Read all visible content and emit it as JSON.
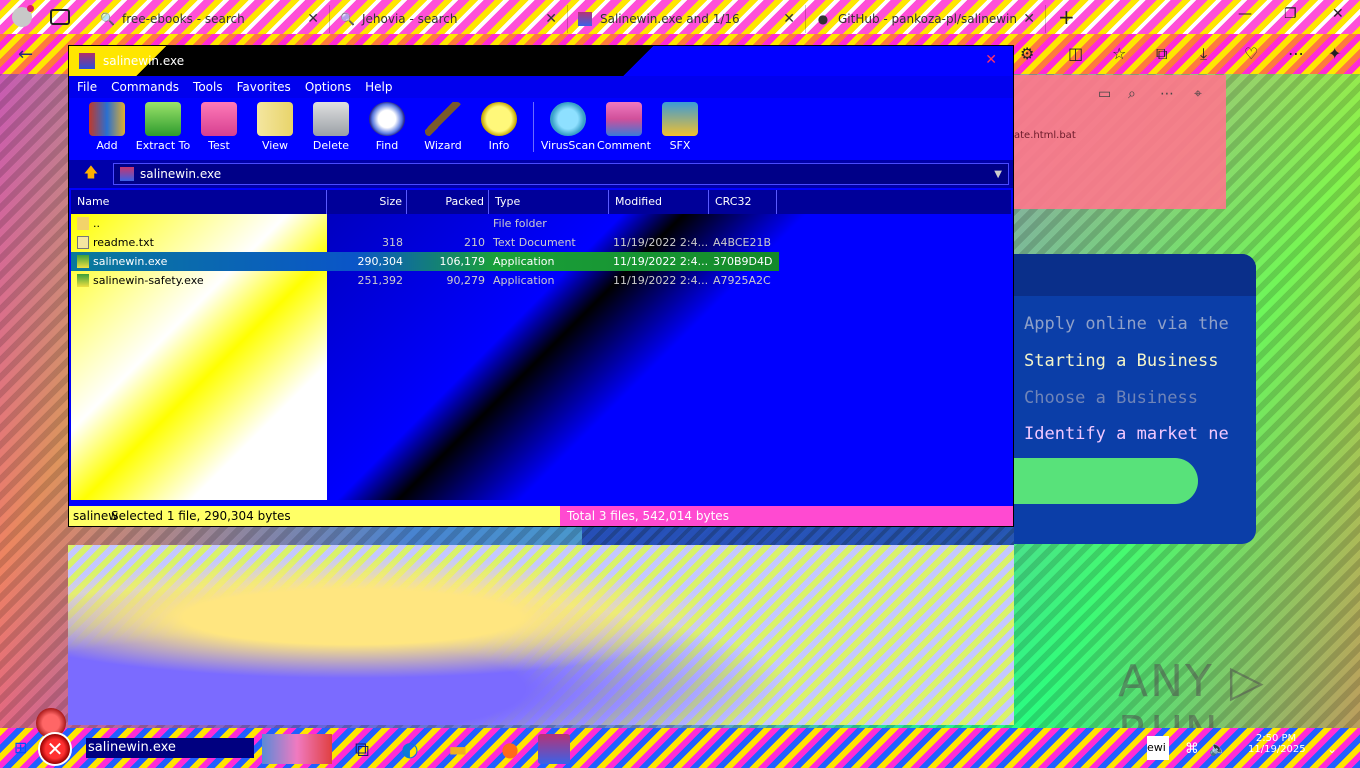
{
  "browser": {
    "tabs": [
      {
        "label": "free-ebooks - search",
        "icon": "search-icon"
      },
      {
        "label": "Jehovia - search",
        "icon": "search-icon"
      },
      {
        "label": "Salinewin.exe and 1/16",
        "icon": "winrar-icon"
      },
      {
        "label": "GitHub - pankoza-pl/salinewin",
        "icon": "github-icon"
      }
    ],
    "new_tab": "+"
  },
  "winrar": {
    "title": "salinewin.exe",
    "menu": [
      "File",
      "Commands",
      "Tools",
      "Favorites",
      "Options",
      "Help"
    ],
    "toolbar": [
      {
        "label": "Add",
        "icon": "add-archive-icon",
        "color": "#c0392b"
      },
      {
        "label": "Extract To",
        "icon": "extract-folder-icon",
        "color": "#2e9b2e"
      },
      {
        "label": "Test",
        "icon": "test-clipboard-icon",
        "color": "#d64090"
      },
      {
        "label": "View",
        "icon": "view-book-icon",
        "color": "#e8d46a"
      },
      {
        "label": "Delete",
        "icon": "delete-bin-icon",
        "color": "#9aa0a6"
      },
      {
        "label": "Find",
        "icon": "find-magnifier-icon",
        "color": "#d8d8ff"
      },
      {
        "label": "Wizard",
        "icon": "wizard-wand-icon",
        "color": "#7a5a2a"
      },
      {
        "label": "Info",
        "icon": "info-icon",
        "color": "#f0e23a"
      },
      {
        "label": "VirusScan",
        "icon": "virusscan-icon",
        "color": "#3aa0c8"
      },
      {
        "label": "Comment",
        "icon": "comment-books-icon",
        "color": "#d0509a"
      },
      {
        "label": "SFX",
        "icon": "sfx-box-icon",
        "color": "#f0c030"
      }
    ],
    "path": "salinewin.exe",
    "columns": [
      "Name",
      "Size",
      "Packed",
      "Type",
      "Modified",
      "CRC32"
    ],
    "files": [
      {
        "name": "..",
        "size": "",
        "packed": "",
        "type": "File folder",
        "modified": "",
        "crc": ""
      },
      {
        "name": "readme.txt",
        "size": "318",
        "packed": "210",
        "type": "Text Document",
        "modified": "11/19/2022 2:4...",
        "crc": "A4BCE21B"
      },
      {
        "name": "salinewin.exe",
        "size": "290,304",
        "packed": "106,179",
        "type": "Application",
        "modified": "11/19/2022 2:4...",
        "crc": "370B9D4D"
      },
      {
        "name": "salinewin-safety.exe",
        "size": "251,392",
        "packed": "90,279",
        "type": "Application",
        "modified": "11/19/2022 2:4...",
        "crc": "A7925A2C"
      }
    ],
    "status_left": "salinew",
    "status_selected": "Selected 1 file, 290,304 bytes",
    "status_total": "Total 3 files, 542,014 bytes"
  },
  "page": {
    "pink_text": "ate.html.bat",
    "code_lines": [
      {
        "text": "Apply online via the",
        "color": "#8fa0c8"
      },
      {
        "text": "Starting a Business",
        "color": "#f4f4c8"
      },
      {
        "text": "Choose a Business",
        "color": "#6f84b8"
      },
      {
        "text": "Identify a market ne",
        "color": "#f2c8ff"
      }
    ],
    "watermark": "ANY ▷ RUN"
  },
  "taskbar": {
    "search_text": "salinewin.exe",
    "tray_badge": "ewi",
    "clock_time": "2:50 PM",
    "clock_date": "11/19/2025"
  }
}
